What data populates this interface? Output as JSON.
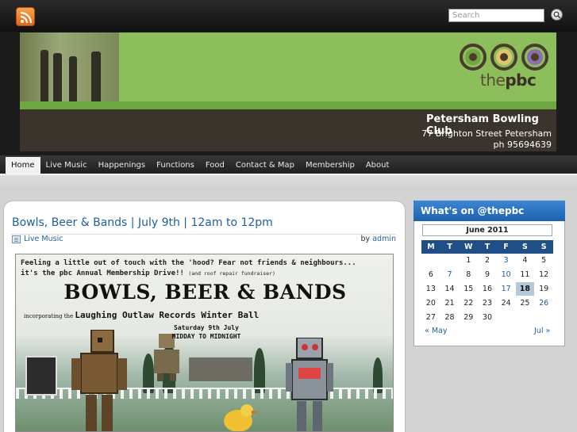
{
  "search": {
    "placeholder": "Search"
  },
  "header": {
    "logo_light": "the",
    "logo_bold": "pbc",
    "club_name": "Petersham Bowling Club",
    "address": "77 Brighton Street Petersham",
    "phone": "ph 95694639"
  },
  "nav": {
    "items": [
      {
        "label": "Home"
      },
      {
        "label": "Live Music"
      },
      {
        "label": "Happenings"
      },
      {
        "label": "Functions"
      },
      {
        "label": "Food"
      },
      {
        "label": "Contact & Map"
      },
      {
        "label": "Membership"
      },
      {
        "label": "About"
      }
    ],
    "active_index": 0
  },
  "post": {
    "title": "Bowls, Beer & Bands | July 9th | 12am to 12pm",
    "category": "Live Music",
    "by_prefix": "by",
    "author": "admin"
  },
  "poster": {
    "line1": "Feeling a little out of touch with the 'hood? Fear not friends & neighbours...",
    "line2": "it's the pbc Annual Membership Drive!!",
    "line2_small": "(and roof repair fundraiser)",
    "headline": "BOWLS, BEER & BANDS",
    "sub_prefix": "incorporating the",
    "sub_main": "Laughing Outlaw Records Winter Ball",
    "date": "Saturday 9th July",
    "time": "MIDDAY TO MIDNIGHT"
  },
  "calendar": {
    "widget_title": "What's on @thepbc",
    "month": "June 2011",
    "weekdays": [
      "M",
      "T",
      "W",
      "T",
      "F",
      "S",
      "S"
    ],
    "weeks": [
      [
        "",
        "",
        "1",
        "2",
        "3",
        "4",
        "5"
      ],
      [
        "6",
        "7",
        "8",
        "9",
        "10",
        "11",
        "12"
      ],
      [
        "13",
        "14",
        "15",
        "16",
        "17",
        "18",
        "19"
      ],
      [
        "20",
        "21",
        "22",
        "23",
        "24",
        "25",
        "26"
      ],
      [
        "27",
        "28",
        "29",
        "30",
        "",
        "",
        ""
      ]
    ],
    "linked_days": [
      "3",
      "7",
      "10",
      "17",
      "26"
    ],
    "today": "18",
    "prev": "« May",
    "next": "Jul »"
  },
  "colors": {
    "accent_blue": "#1f5f9e",
    "banner_green": "#8cbf5c",
    "widget_header": "#2b74c2"
  }
}
